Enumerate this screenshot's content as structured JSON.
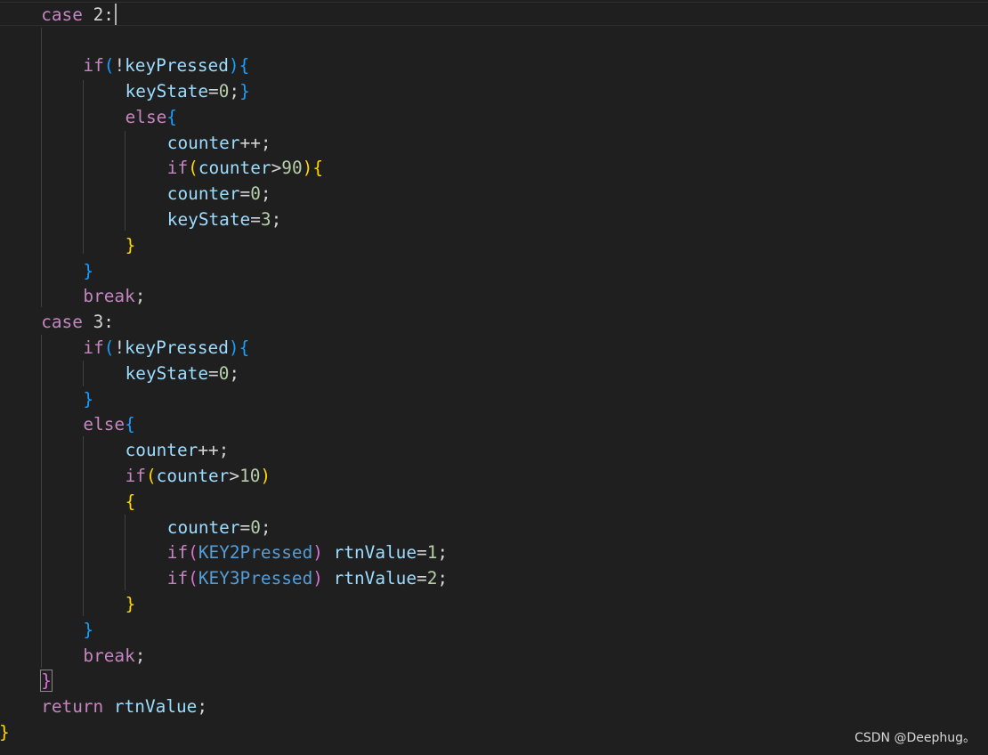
{
  "editor": {
    "lines": [
      {
        "indent": 1,
        "tokens": [
          {
            "t": "case",
            "c": "kw"
          },
          {
            "t": " 2:",
            "c": "op"
          }
        ]
      },
      {
        "indent": 0,
        "tokens": []
      },
      {
        "indent": 2,
        "tokens": [
          {
            "t": "if",
            "c": "kw"
          },
          {
            "t": "(",
            "c": "b3"
          },
          {
            "t": "!",
            "c": "op"
          },
          {
            "t": "keyPressed",
            "c": "var"
          },
          {
            "t": ")",
            "c": "b3"
          },
          {
            "t": "{",
            "c": "b3"
          }
        ]
      },
      {
        "indent": 3,
        "tokens": [
          {
            "t": "keyState",
            "c": "var"
          },
          {
            "t": "=",
            "c": "op"
          },
          {
            "t": "0",
            "c": "num"
          },
          {
            "t": ";",
            "c": "op"
          },
          {
            "t": "}",
            "c": "b3"
          }
        ]
      },
      {
        "indent": 3,
        "tokens": [
          {
            "t": "else",
            "c": "kw"
          },
          {
            "t": "{",
            "c": "b3"
          }
        ]
      },
      {
        "indent": 4,
        "tokens": [
          {
            "t": "counter",
            "c": "var"
          },
          {
            "t": "++;",
            "c": "op"
          }
        ]
      },
      {
        "indent": 4,
        "tokens": [
          {
            "t": "if",
            "c": "kw"
          },
          {
            "t": "(",
            "c": "b1"
          },
          {
            "t": "counter",
            "c": "var"
          },
          {
            "t": ">",
            "c": "op"
          },
          {
            "t": "90",
            "c": "num"
          },
          {
            "t": ")",
            "c": "b1"
          },
          {
            "t": "{",
            "c": "b1"
          }
        ]
      },
      {
        "indent": 4,
        "tokens": [
          {
            "t": "counter",
            "c": "var"
          },
          {
            "t": "=",
            "c": "op"
          },
          {
            "t": "0",
            "c": "num"
          },
          {
            "t": ";",
            "c": "op"
          }
        ]
      },
      {
        "indent": 4,
        "tokens": [
          {
            "t": "keyState",
            "c": "var"
          },
          {
            "t": "=",
            "c": "op"
          },
          {
            "t": "3",
            "c": "num"
          },
          {
            "t": ";",
            "c": "op"
          }
        ]
      },
      {
        "indent": 3,
        "tokens": [
          {
            "t": "}",
            "c": "b1"
          }
        ]
      },
      {
        "indent": 2,
        "tokens": [
          {
            "t": "}",
            "c": "b3"
          }
        ]
      },
      {
        "indent": 2,
        "tokens": [
          {
            "t": "break",
            "c": "kw"
          },
          {
            "t": ";",
            "c": "op"
          }
        ]
      },
      {
        "indent": 1,
        "tokens": [
          {
            "t": "case",
            "c": "kw"
          },
          {
            "t": " 3:",
            "c": "op"
          }
        ]
      },
      {
        "indent": 2,
        "tokens": [
          {
            "t": "if",
            "c": "kw"
          },
          {
            "t": "(",
            "c": "b3"
          },
          {
            "t": "!",
            "c": "op"
          },
          {
            "t": "keyPressed",
            "c": "var"
          },
          {
            "t": ")",
            "c": "b3"
          },
          {
            "t": "{",
            "c": "b3"
          }
        ]
      },
      {
        "indent": 3,
        "tokens": [
          {
            "t": "keyState",
            "c": "var"
          },
          {
            "t": "=",
            "c": "op"
          },
          {
            "t": "0",
            "c": "num"
          },
          {
            "t": ";",
            "c": "op"
          }
        ]
      },
      {
        "indent": 2,
        "tokens": [
          {
            "t": "}",
            "c": "b3"
          }
        ]
      },
      {
        "indent": 2,
        "tokens": [
          {
            "t": "else",
            "c": "kw"
          },
          {
            "t": "{",
            "c": "b3"
          }
        ]
      },
      {
        "indent": 3,
        "tokens": [
          {
            "t": "counter",
            "c": "var"
          },
          {
            "t": "++;",
            "c": "op"
          }
        ]
      },
      {
        "indent": 3,
        "tokens": [
          {
            "t": "if",
            "c": "kw"
          },
          {
            "t": "(",
            "c": "b1"
          },
          {
            "t": "counter",
            "c": "var"
          },
          {
            "t": ">",
            "c": "op"
          },
          {
            "t": "10",
            "c": "num"
          },
          {
            "t": ")",
            "c": "b1"
          }
        ]
      },
      {
        "indent": 3,
        "tokens": [
          {
            "t": "{",
            "c": "b1"
          }
        ]
      },
      {
        "indent": 4,
        "tokens": [
          {
            "t": "counter",
            "c": "var"
          },
          {
            "t": "=",
            "c": "op"
          },
          {
            "t": "0",
            "c": "num"
          },
          {
            "t": ";",
            "c": "op"
          }
        ]
      },
      {
        "indent": 4,
        "tokens": [
          {
            "t": "if",
            "c": "kw"
          },
          {
            "t": "(",
            "c": "b2"
          },
          {
            "t": "KEY2Pressed",
            "c": "mac"
          },
          {
            "t": ")",
            "c": "b2"
          },
          {
            "t": " ",
            "c": "op"
          },
          {
            "t": "rtnValue",
            "c": "var"
          },
          {
            "t": "=",
            "c": "op"
          },
          {
            "t": "1",
            "c": "num"
          },
          {
            "t": ";",
            "c": "op"
          }
        ]
      },
      {
        "indent": 4,
        "tokens": [
          {
            "t": "if",
            "c": "kw"
          },
          {
            "t": "(",
            "c": "b2"
          },
          {
            "t": "KEY3Pressed",
            "c": "mac"
          },
          {
            "t": ")",
            "c": "b2"
          },
          {
            "t": " ",
            "c": "op"
          },
          {
            "t": "rtnValue",
            "c": "var"
          },
          {
            "t": "=",
            "c": "op"
          },
          {
            "t": "2",
            "c": "num"
          },
          {
            "t": ";",
            "c": "op"
          }
        ]
      },
      {
        "indent": 3,
        "tokens": [
          {
            "t": "}",
            "c": "b1"
          }
        ]
      },
      {
        "indent": 2,
        "tokens": [
          {
            "t": "}",
            "c": "b3"
          }
        ]
      },
      {
        "indent": 2,
        "tokens": [
          {
            "t": "break",
            "c": "kw"
          },
          {
            "t": ";",
            "c": "op"
          }
        ]
      },
      {
        "indent": 1,
        "tokens": [
          {
            "t": "}",
            "c": "b2"
          }
        ]
      },
      {
        "indent": 1,
        "tokens": [
          {
            "t": "return",
            "c": "kw"
          },
          {
            "t": " ",
            "c": "op"
          },
          {
            "t": "rtnValue",
            "c": "var"
          },
          {
            "t": ";",
            "c": "op"
          }
        ]
      },
      {
        "indent": 0,
        "tokens": [
          {
            "t": "}",
            "c": "b1"
          }
        ]
      }
    ]
  },
  "colors": {
    "background": "#1f1f1f",
    "keyword": "#c586c0",
    "variable": "#9cdcfe",
    "number": "#b5cea8",
    "macro": "#569cd6",
    "bracket_gold": "#ffd700",
    "bracket_orchid": "#da70d6",
    "bracket_blue": "#179fff"
  },
  "watermark": "CSDN @Deephug。"
}
